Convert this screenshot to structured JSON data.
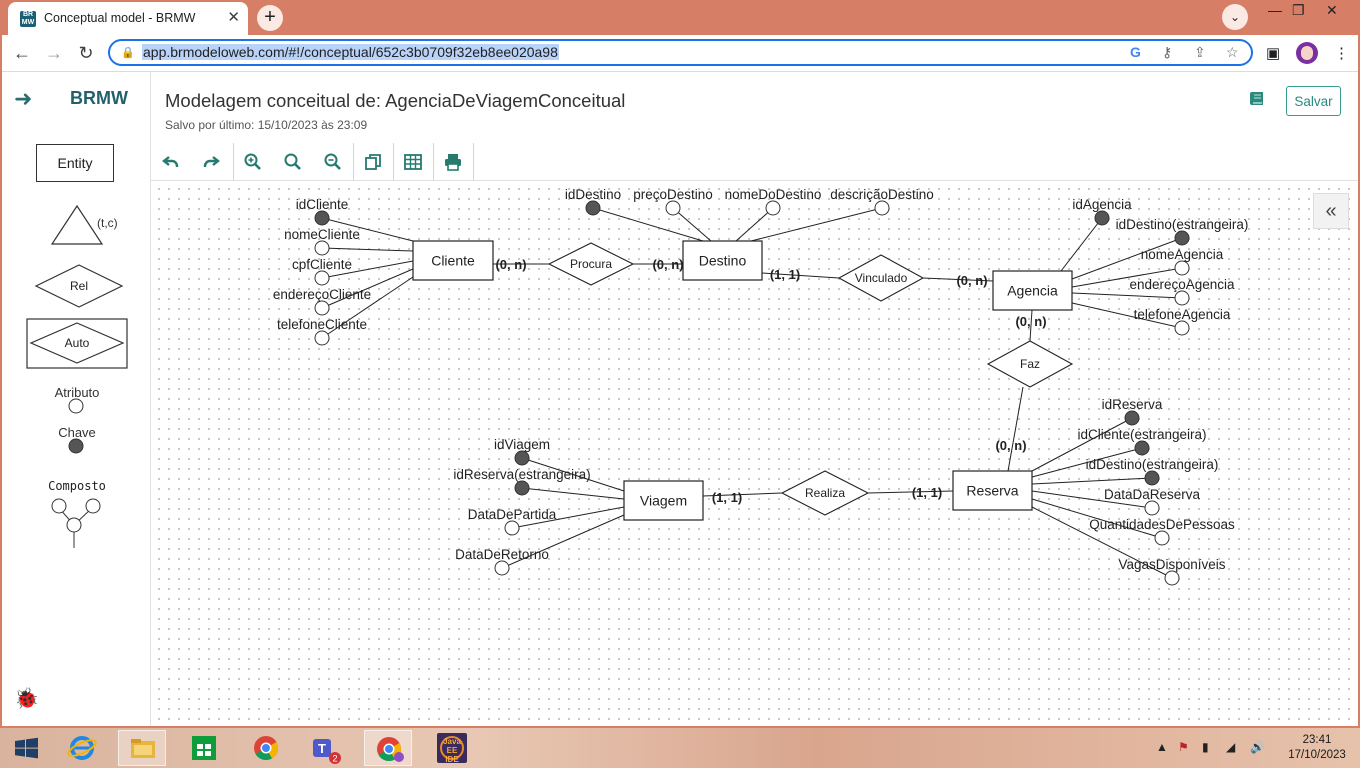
{
  "browser": {
    "tab_title": "Conceptual model - BRMW",
    "favicon_text": "BR MW",
    "url": "app.brmodeloweb.com/#!/conceptual/652c3b0709f32eb8ee020a98"
  },
  "app": {
    "brand": "BRMW",
    "title": "Modelagem conceitual de: AgenciaDeViagemConceitual",
    "subtitle": "Salvo por último: 15/10/2023 às 23:09",
    "save_label": "Salvar"
  },
  "palette": {
    "entity": "Entity",
    "specialization": "(t,c)",
    "rel": "Rel",
    "auto": "Auto",
    "atributo": "Atributo",
    "chave": "Chave",
    "composto": "Composto"
  },
  "toolbar_icons": [
    "undo-icon",
    "redo-icon",
    "zoom-in-icon",
    "zoom-reset-icon",
    "zoom-out-icon",
    "duplicate-icon",
    "table-icon",
    "print-icon"
  ],
  "diagram": {
    "entities": [
      {
        "id": "cliente",
        "label": "Cliente"
      },
      {
        "id": "destino",
        "label": "Destino"
      },
      {
        "id": "agencia",
        "label": "Agencia"
      },
      {
        "id": "reserva",
        "label": "Reserva"
      },
      {
        "id": "viagem",
        "label": "Viagem"
      }
    ],
    "relationships": [
      {
        "id": "procura",
        "label": "Procura",
        "entity_a": "cliente",
        "card_a": "(0, n)",
        "entity_b": "destino",
        "card_b": "(0, n)"
      },
      {
        "id": "vinculado",
        "label": "Vinculado",
        "entity_a": "destino",
        "card_a": "(1, 1)",
        "entity_b": "agencia",
        "card_b": "(0, n)"
      },
      {
        "id": "faz",
        "label": "Faz",
        "entity_a": "agencia",
        "card_a": "(0, n)",
        "entity_b": "reserva",
        "card_b": "(0, n)"
      },
      {
        "id": "realiza",
        "label": "Realiza",
        "entity_a": "viagem",
        "card_a": "(1, 1)",
        "entity_b": "reserva",
        "card_b": "(1, 1)"
      }
    ],
    "attributes": [
      {
        "entity": "cliente",
        "label": "idCliente",
        "key": true
      },
      {
        "entity": "cliente",
        "label": "nomeCliente",
        "key": false
      },
      {
        "entity": "cliente",
        "label": "cpfCliente",
        "key": false
      },
      {
        "entity": "cliente",
        "label": "endereçoCliente",
        "key": false
      },
      {
        "entity": "cliente",
        "label": "telefoneCliente",
        "key": false
      },
      {
        "entity": "destino",
        "label": "idDestino",
        "key": true
      },
      {
        "entity": "destino",
        "label": "preçoDestino",
        "key": false
      },
      {
        "entity": "destino",
        "label": "nomeDoDestino",
        "key": false
      },
      {
        "entity": "destino",
        "label": "descriçãoDestino",
        "key": false
      },
      {
        "entity": "agencia",
        "label": "idAgencia",
        "key": true
      },
      {
        "entity": "agencia",
        "label": "idDestino(estrangeira)",
        "key": true
      },
      {
        "entity": "agencia",
        "label": "nomeAgencia",
        "key": false
      },
      {
        "entity": "agencia",
        "label": "endereçoAgencia",
        "key": false
      },
      {
        "entity": "agencia",
        "label": "telefoneAgencia",
        "key": false
      },
      {
        "entity": "reserva",
        "label": "idReserva",
        "key": true
      },
      {
        "entity": "reserva",
        "label": "idCliente(estrangeira)",
        "key": true
      },
      {
        "entity": "reserva",
        "label": "idDestino(estrangeira)",
        "key": true
      },
      {
        "entity": "reserva",
        "label": "DataDaReserva",
        "key": false
      },
      {
        "entity": "reserva",
        "label": "QuantidadesDePessoas",
        "key": false
      },
      {
        "entity": "reserva",
        "label": "VagasDisponíveis",
        "key": false
      },
      {
        "entity": "viagem",
        "label": "idViagem",
        "key": true
      },
      {
        "entity": "viagem",
        "label": "idReserva(estrangeira)",
        "key": true
      },
      {
        "entity": "viagem",
        "label": "DataDePartida",
        "key": false
      },
      {
        "entity": "viagem",
        "label": "DataDeRetorno",
        "key": false
      }
    ]
  },
  "taskbar": {
    "time": "23:41",
    "date": "17/10/2023",
    "java_label": "Java EE IDE"
  },
  "colors": {
    "titlebar": "#d77f66",
    "brand": "#22616b",
    "accent": "#2a8a7e",
    "key_fill": "#555555"
  }
}
